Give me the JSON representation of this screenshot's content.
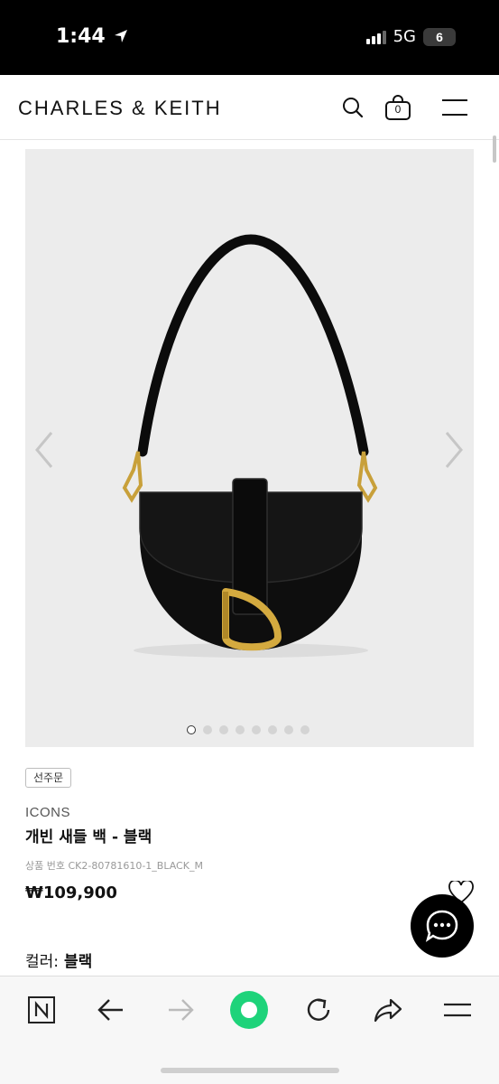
{
  "status_bar": {
    "time": "1:44",
    "network": "5G",
    "battery": "6"
  },
  "header": {
    "brand": "CHARLES & KEITH",
    "cart_count": "0",
    "icons": [
      "search-icon",
      "shopping-bag-icon",
      "menu-icon"
    ]
  },
  "gallery": {
    "image_count": 8,
    "active_index": 0
  },
  "product": {
    "badge": "선주문",
    "collection": "ICONS",
    "name": "개빈 새들 백 - 블랙",
    "sku": "상품 번호 CK2-80781610-1_BLACK_M",
    "price": "₩109,900",
    "color_label": "컬러:",
    "color_value": "블랙"
  },
  "browser_toolbar": {
    "icons": [
      "naver-n-icon",
      "back-arrow-icon",
      "forward-arrow-icon",
      "green-dot-icon",
      "refresh-icon",
      "share-icon",
      "menu-icon"
    ]
  },
  "colors": {
    "accent_green": "#1ed37a",
    "product_bg": "#ececec"
  }
}
